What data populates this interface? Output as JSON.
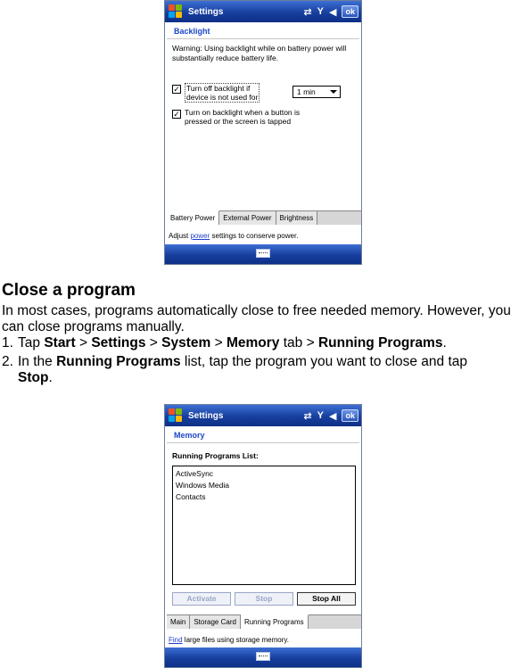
{
  "screen1": {
    "title": "Settings",
    "ok_label": "ok",
    "section_title": "Backlight",
    "warning": "Warning: Using backlight while on battery power will substantially reduce battery life.",
    "option1_line1": "Turn off backlight if",
    "option1_line2": "device is not used for",
    "option1_value": "1 min",
    "option2_line1": "Turn on backlight when a button is",
    "option2_line2": "pressed or the screen is tapped",
    "tabs": [
      "Battery Power",
      "External Power",
      "Brightness"
    ],
    "hint_prefix": "Adjust ",
    "hint_link": "power",
    "hint_suffix": " settings to conserve power."
  },
  "doc": {
    "heading": "Close a program",
    "intro": "In most cases, programs automatically close to free needed memory. However, you can close programs manually.",
    "step1": {
      "num": "1.",
      "t1": "Tap ",
      "b1": "Start",
      "t2": " > ",
      "b2": "Settings",
      "t3": " > ",
      "b3": "System",
      "t4": " > ",
      "b4": "Memory",
      "t5": " tab > ",
      "b5": "Running Programs",
      "t6": "."
    },
    "step2": {
      "num": "2.",
      "t1": "In the ",
      "b1": "Running Programs",
      "t2": " list, tap the program you want to close and tap",
      "b2": "Stop",
      "t3": "."
    }
  },
  "screen2": {
    "title": "Settings",
    "ok_label": "ok",
    "section_title": "Memory",
    "list_title": "Running Programs List:",
    "programs": [
      "ActiveSync",
      "Windows Media",
      "Contacts"
    ],
    "buttons": {
      "activate": "Activate",
      "stop": "Stop",
      "stop_all": "Stop All"
    },
    "tabs": [
      "Main",
      "Storage Card",
      "Running Programs"
    ],
    "hint_link": "Find",
    "hint_suffix": " large files using storage memory."
  }
}
